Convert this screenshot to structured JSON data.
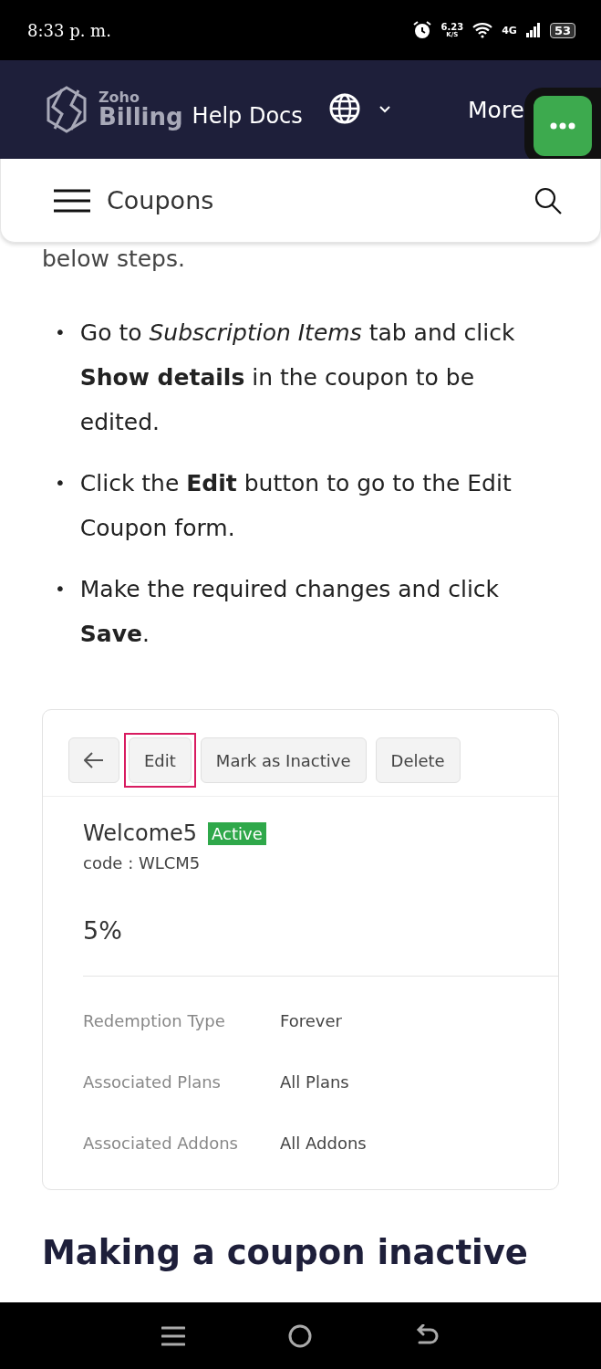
{
  "status_bar": {
    "time": "8:33 p. m.",
    "speed": "6.23",
    "speed_unit": "K/S",
    "network": "4G",
    "battery": "53"
  },
  "header": {
    "brand_small": "Zoho",
    "brand": "Billing",
    "title": "Help Docs",
    "more": "More"
  },
  "subheader": {
    "title": "Coupons"
  },
  "content": {
    "lead": "below steps.",
    "steps": [
      {
        "marker": "•",
        "text": "Go to *Subscription Items* tab and click **Show details** in the coupon to be edited."
      },
      {
        "marker": "•",
        "text": "Click the **Edit** button to go to the Edit Coupon form."
      },
      {
        "marker": "•",
        "text": "Make the required changes and click **Save**."
      }
    ],
    "figure": {
      "toolbar": [
        {
          "kind": "back"
        },
        {
          "kind": "text",
          "label": "Edit",
          "highlighted": true
        },
        {
          "kind": "text",
          "label": "Mark as Inactive",
          "highlighted": false
        },
        {
          "kind": "text",
          "label": "Delete",
          "highlighted": false
        }
      ],
      "coupon": {
        "name": "Welcome5",
        "status": "Active",
        "code": "code : WLCM5",
        "value": "5%"
      },
      "details": [
        {
          "label": "Redemption Type",
          "value": "Forever"
        },
        {
          "label": "Associated Plans",
          "value": "All Plans"
        },
        {
          "label": "Associated Addons",
          "value": "All Addons"
        }
      ]
    },
    "next_heading": "Making a coupon inactive"
  }
}
